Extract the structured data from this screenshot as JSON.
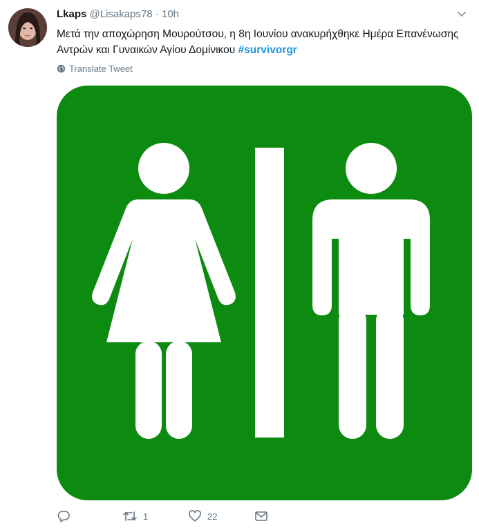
{
  "tweet": {
    "display_name": "Lkaps",
    "handle": "@Lisakaps78",
    "separator": "·",
    "time": "10h",
    "text_main": "Μετά την αποχώρηση Μουρούτσου, η 8η Ιουνίου ανακυρήχθηκε Ημέρα Επανένωσης Αντρών και Γυναικών Αγίου Δομίνικου ",
    "hashtag": "#survivorgr",
    "translate_label": "Translate Tweet"
  },
  "media": {
    "description_icon": "restroom-sign",
    "background_color": "#0d8a10",
    "figure_color": "#ffffff"
  },
  "actions": {
    "reply_count": "",
    "retweet_count": "1",
    "like_count": "22"
  },
  "colors": {
    "text": "#14171a",
    "muted": "#657786",
    "link": "#1b95e0"
  }
}
